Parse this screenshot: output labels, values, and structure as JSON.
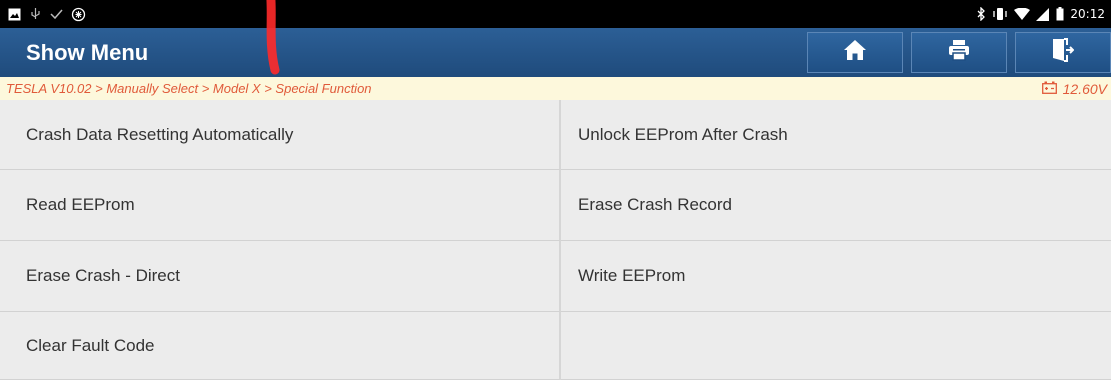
{
  "statusbar": {
    "left_icons": [
      "image-icon",
      "usb-icon",
      "check-icon",
      "bug-icon"
    ],
    "right_icons": [
      "bluetooth-icon",
      "vibrate-icon",
      "wifi-icon",
      "signal-icon",
      "battery-icon"
    ],
    "time": "20:12"
  },
  "header": {
    "title": "Show Menu",
    "buttons": [
      "home-icon",
      "print-icon",
      "exit-icon"
    ]
  },
  "breadcrumb": {
    "path": "TESLA V10.02 > Manually Select > Model X > Special Function",
    "voltage": "12.60V"
  },
  "menu": {
    "items": [
      "Crash Data Resetting Automatically",
      "Unlock EEProm After Crash",
      "Read EEProm",
      "Erase Crash Record",
      "Erase Crash - Direct",
      "Write EEProm",
      "Clear Fault Code",
      ""
    ]
  },
  "colors": {
    "header": "#1f4b7c",
    "breadcrumb_text": "#e05a3a",
    "breadcrumb_bg": "#fdf8dc",
    "menu_bg": "#ececec"
  }
}
